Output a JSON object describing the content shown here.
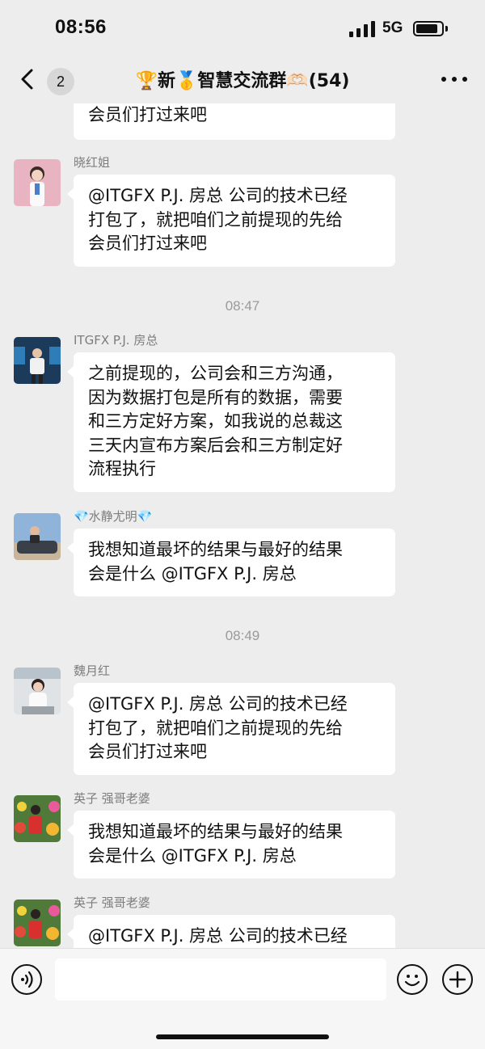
{
  "status_bar": {
    "time": "08:56",
    "network": "5G",
    "battery_level": 0.85
  },
  "nav": {
    "back_count": "2",
    "title": "🏆新🥇智慧交流群🫶🏻(54)"
  },
  "messages": [
    {
      "sender": "",
      "text": "会员们打过来吧",
      "avatar_icon": ""
    },
    {
      "sender": "晓红姐",
      "text": "@ITGFX P.J. 房总 公司的技术已经打包了，就把咱们之前提现的先给会员们打过来吧",
      "avatar_icon": "avatar-pink"
    },
    {
      "timestamp": "08:47"
    },
    {
      "sender": "ITGFX P.J. 房总",
      "text": "之前提现的，公司会和三方沟通，因为数据打包是所有的数据，需要和三方定好方案，如我说的总裁这三天内宣布方案后会和三方制定好流程执行",
      "avatar_icon": "avatar-stage"
    },
    {
      "sender": "💎水静尤明💎",
      "text": "我想知道最坏的结果与最好的结果会是什么 @ITGFX P.J. 房总",
      "avatar_icon": "avatar-car"
    },
    {
      "timestamp": "08:49"
    },
    {
      "sender": "魏月红",
      "text": "@ITGFX P.J. 房总 公司的技术已经打包了，就把咱们之前提现的先给会员们打过来吧",
      "avatar_icon": "avatar-office"
    },
    {
      "sender": "英子  强哥老婆",
      "text": "我想知道最坏的结果与最好的结果会是什么 @ITGFX P.J. 房总",
      "avatar_icon": "avatar-flowers"
    },
    {
      "sender": "英子  强哥老婆",
      "text": "@ITGFX P.J. 房总 公司的技术已经",
      "avatar_icon": "avatar-flowers"
    }
  ],
  "bubble_lines": {
    "m0": [
      "会员们打过来吧"
    ],
    "m1": [
      "@ITGFX P.J. 房总 公司的技术已经",
      "打包了，就把咱们之前提现的先给",
      "会员们打过来吧"
    ],
    "m3": [
      "之前提现的，公司会和三方沟通，",
      "因为数据打包是所有的数据，需要",
      "和三方定好方案，如我说的总裁这",
      "三天内宣布方案后会和三方制定好",
      "流程执行"
    ],
    "m4": [
      "我想知道最坏的结果与最好的结果",
      "会是什么 @ITGFX P.J. 房总"
    ],
    "m6": [
      "@ITGFX P.J. 房总 公司的技术已经",
      "打包了，就把咱们之前提现的先给",
      "会员们打过来吧"
    ],
    "m7": [
      "我想知道最坏的结果与最好的结果",
      "会是什么 @ITGFX P.J. 房总"
    ],
    "m8": [
      "@ITGFX P.J. 房总 公司的技术已经"
    ]
  },
  "input": {
    "placeholder": ""
  },
  "colors": {
    "background": "#ededed",
    "bubble": "#ffffff",
    "sender": "#7d7d7d",
    "timestamp": "#9a9a9a"
  }
}
